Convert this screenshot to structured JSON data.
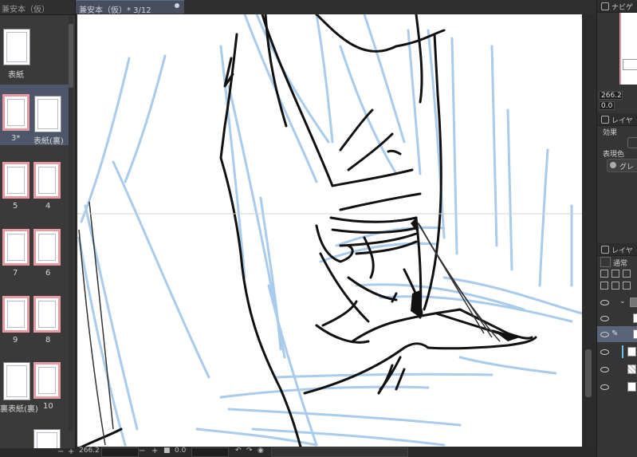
{
  "left_panel": {
    "title": "兼安本（仮）",
    "pages": [
      {
        "label": "表紙"
      },
      {
        "label": "3*"
      },
      {
        "label": "表紙(裏)"
      },
      {
        "label": "5"
      },
      {
        "label": "4"
      },
      {
        "label": "7"
      },
      {
        "label": "6"
      },
      {
        "label": "9"
      },
      {
        "label": "8"
      },
      {
        "label": "裏表紙(裏)"
      },
      {
        "label": "10"
      }
    ]
  },
  "document_tab": {
    "title": "兼安本（仮）* 3/12"
  },
  "bottom_bar": {
    "zoom": "266.2",
    "rotation": "0.0"
  },
  "right_panel": {
    "navigator_tab": "ナビゲ",
    "zoom_value": "266.2",
    "rotation_value": "0.0",
    "layer_property_tab": "レイヤ",
    "effect_label": "効果",
    "expression_color_label": "表現色",
    "expression_color_value": "グレ",
    "layer_tab": "レイヤ",
    "blend_mode": "通常"
  },
  "colors": {
    "sketch_blue": "#a9cbec",
    "ink": "#111111",
    "page_border_pink": "#e89aa2",
    "selected_row": "#4e5769"
  }
}
